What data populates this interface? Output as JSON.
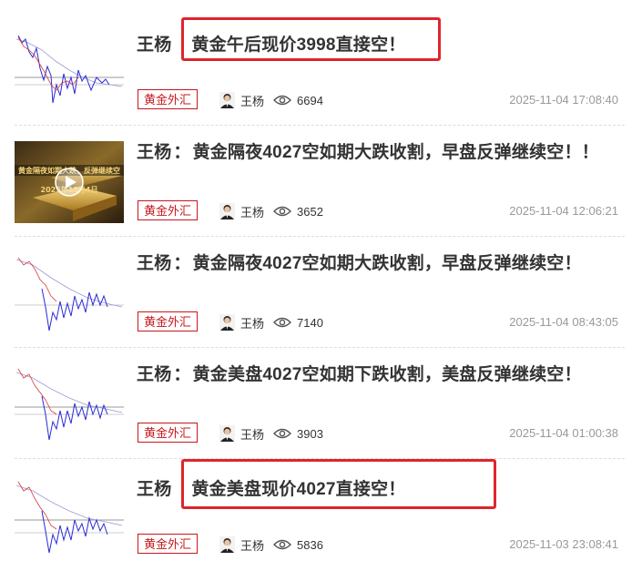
{
  "colors": {
    "accent": "#c6171c",
    "highlight_box": "#e0242b",
    "title": "#333333",
    "meta": "#999999"
  },
  "articles": [
    {
      "author": "王杨",
      "sep": "",
      "headline": "黄金午后现价3998直接空！",
      "highlighted": true,
      "tag": "黄金外汇",
      "author_name": "王杨",
      "views": "6694",
      "date": "2025-11-04 17:08:40",
      "thumb": "chart",
      "video_icon": ""
    },
    {
      "author": "王杨",
      "sep": "：",
      "headline": "黄金隔夜4027空如期大跌收割，早盘反弹继续空！！",
      "highlighted": false,
      "tag": "黄金外汇",
      "author_name": "王杨",
      "views": "3652",
      "date": "2025-11-04 12:06:21",
      "thumb": "video",
      "video_icon": "play-icon",
      "thumb_text": {
        "line1": "黄金隔夜如期大跌，反弹继续空",
        "line2": "2025年11月4日"
      }
    },
    {
      "author": "王杨",
      "sep": "：",
      "headline": "黄金隔夜4027空如期大跌收割，早盘反弹继续空！",
      "highlighted": false,
      "tag": "黄金外汇",
      "author_name": "王杨",
      "views": "7140",
      "date": "2025-11-04 08:43:05",
      "thumb": "chart",
      "video_icon": ""
    },
    {
      "author": "王杨",
      "sep": "：",
      "headline": "黄金美盘4027空如期下跌收割，美盘反弹继续空！",
      "highlighted": false,
      "tag": "黄金外汇",
      "author_name": "王杨",
      "views": "3903",
      "date": "2025-11-04 01:00:38",
      "thumb": "chart",
      "video_icon": ""
    },
    {
      "author": "王杨",
      "sep": "",
      "headline": "黄金美盘现价4027直接空！",
      "highlighted": true,
      "tag": "黄金外汇",
      "author_name": "王杨",
      "views": "5836",
      "date": "2025-11-03 23:08:41",
      "thumb": "chart",
      "video_icon": ""
    }
  ]
}
